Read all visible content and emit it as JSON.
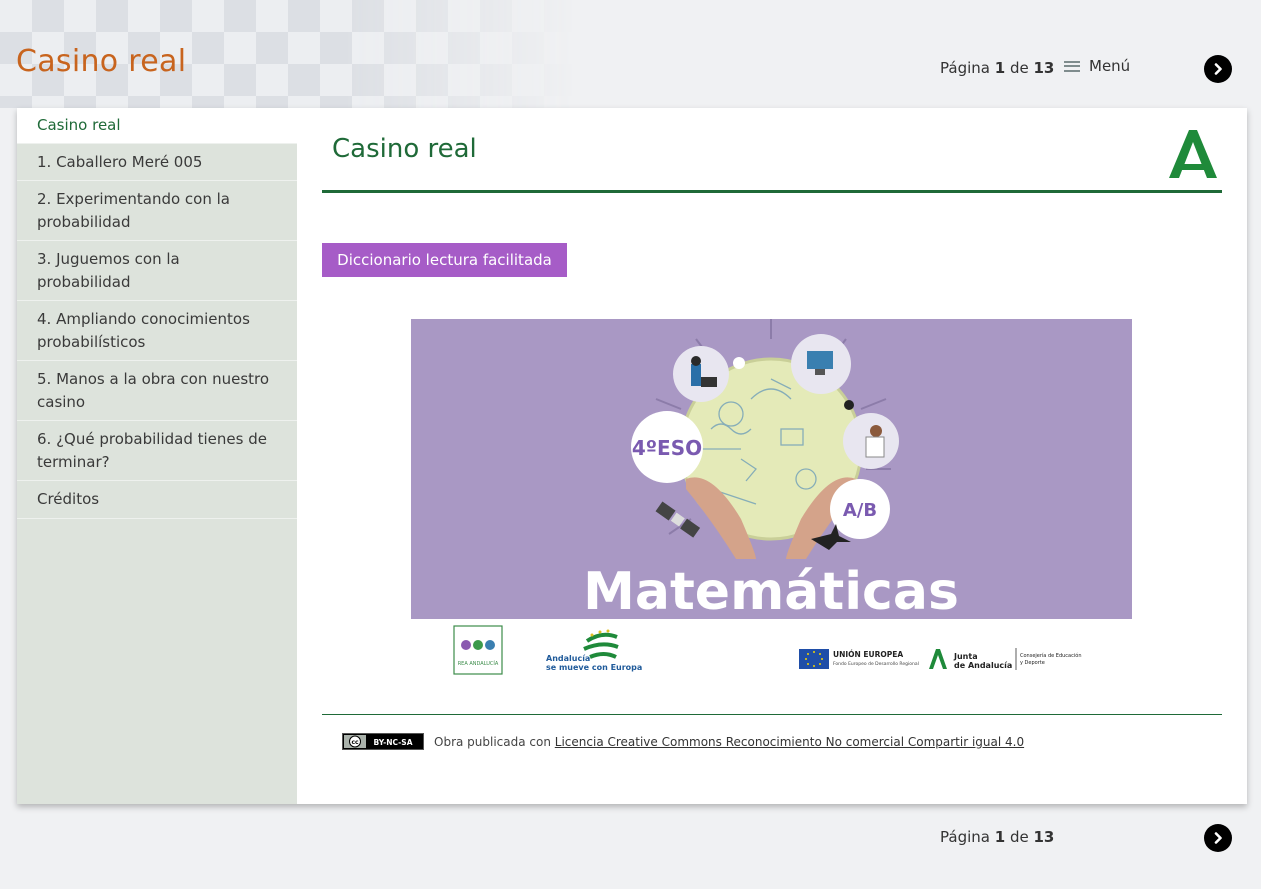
{
  "header": {
    "site_title": "Casino real",
    "pagination": {
      "prefix": "Página",
      "current": "1",
      "separator": "de",
      "total": "13"
    },
    "menu_label": "Menú"
  },
  "sidebar": {
    "items": [
      {
        "label": "Casino real",
        "active": true
      },
      {
        "label": "1. Caballero Meré 005"
      },
      {
        "label": "2. Experimentando con la probabilidad"
      },
      {
        "label": "3. Juguemos con la probabilidad"
      },
      {
        "label": "4. Ampliando conocimientos probabilísticos"
      },
      {
        "label": "5. Manos a la obra con nuestro casino"
      },
      {
        "label": "6. ¿Qué probabilidad tienes de terminar?"
      },
      {
        "label": "Créditos"
      }
    ]
  },
  "main": {
    "title": "Casino real",
    "dictionary_button": "Diccionario lectura facilitada",
    "cover": {
      "course": "4ºESO",
      "level": "A/B",
      "subject": "Matemáticas",
      "rea_logo": "REA ANDALUCÍA",
      "andalucia_europa": [
        "Andalucía",
        "se mueve con Europa"
      ],
      "ue": [
        "UNIÓN EUROPEA",
        "Fondo Europeo de Desarrollo Regional"
      ],
      "junta": [
        "Junta",
        "de Andalucía"
      ],
      "consejeria": [
        "Consejería de Educación",
        "y Deporte"
      ]
    }
  },
  "footer": {
    "cc_badge": "BY-NC-SA",
    "license_prefix": "Obra publicada con",
    "license_link": "Licencia Creative Commons Reconocimiento No comercial Compartir igual 4.0"
  },
  "colors": {
    "title_orange": "#c8641e",
    "accent_green": "#1f6a38",
    "button_purple": "#a65cc7",
    "cover_purple": "#a998c4",
    "sidebar_bg": "#dde3dc"
  },
  "icons": [
    "hamburger-icon",
    "chevron-right-icon",
    "junta-logo-icon",
    "cc-license-icon"
  ]
}
